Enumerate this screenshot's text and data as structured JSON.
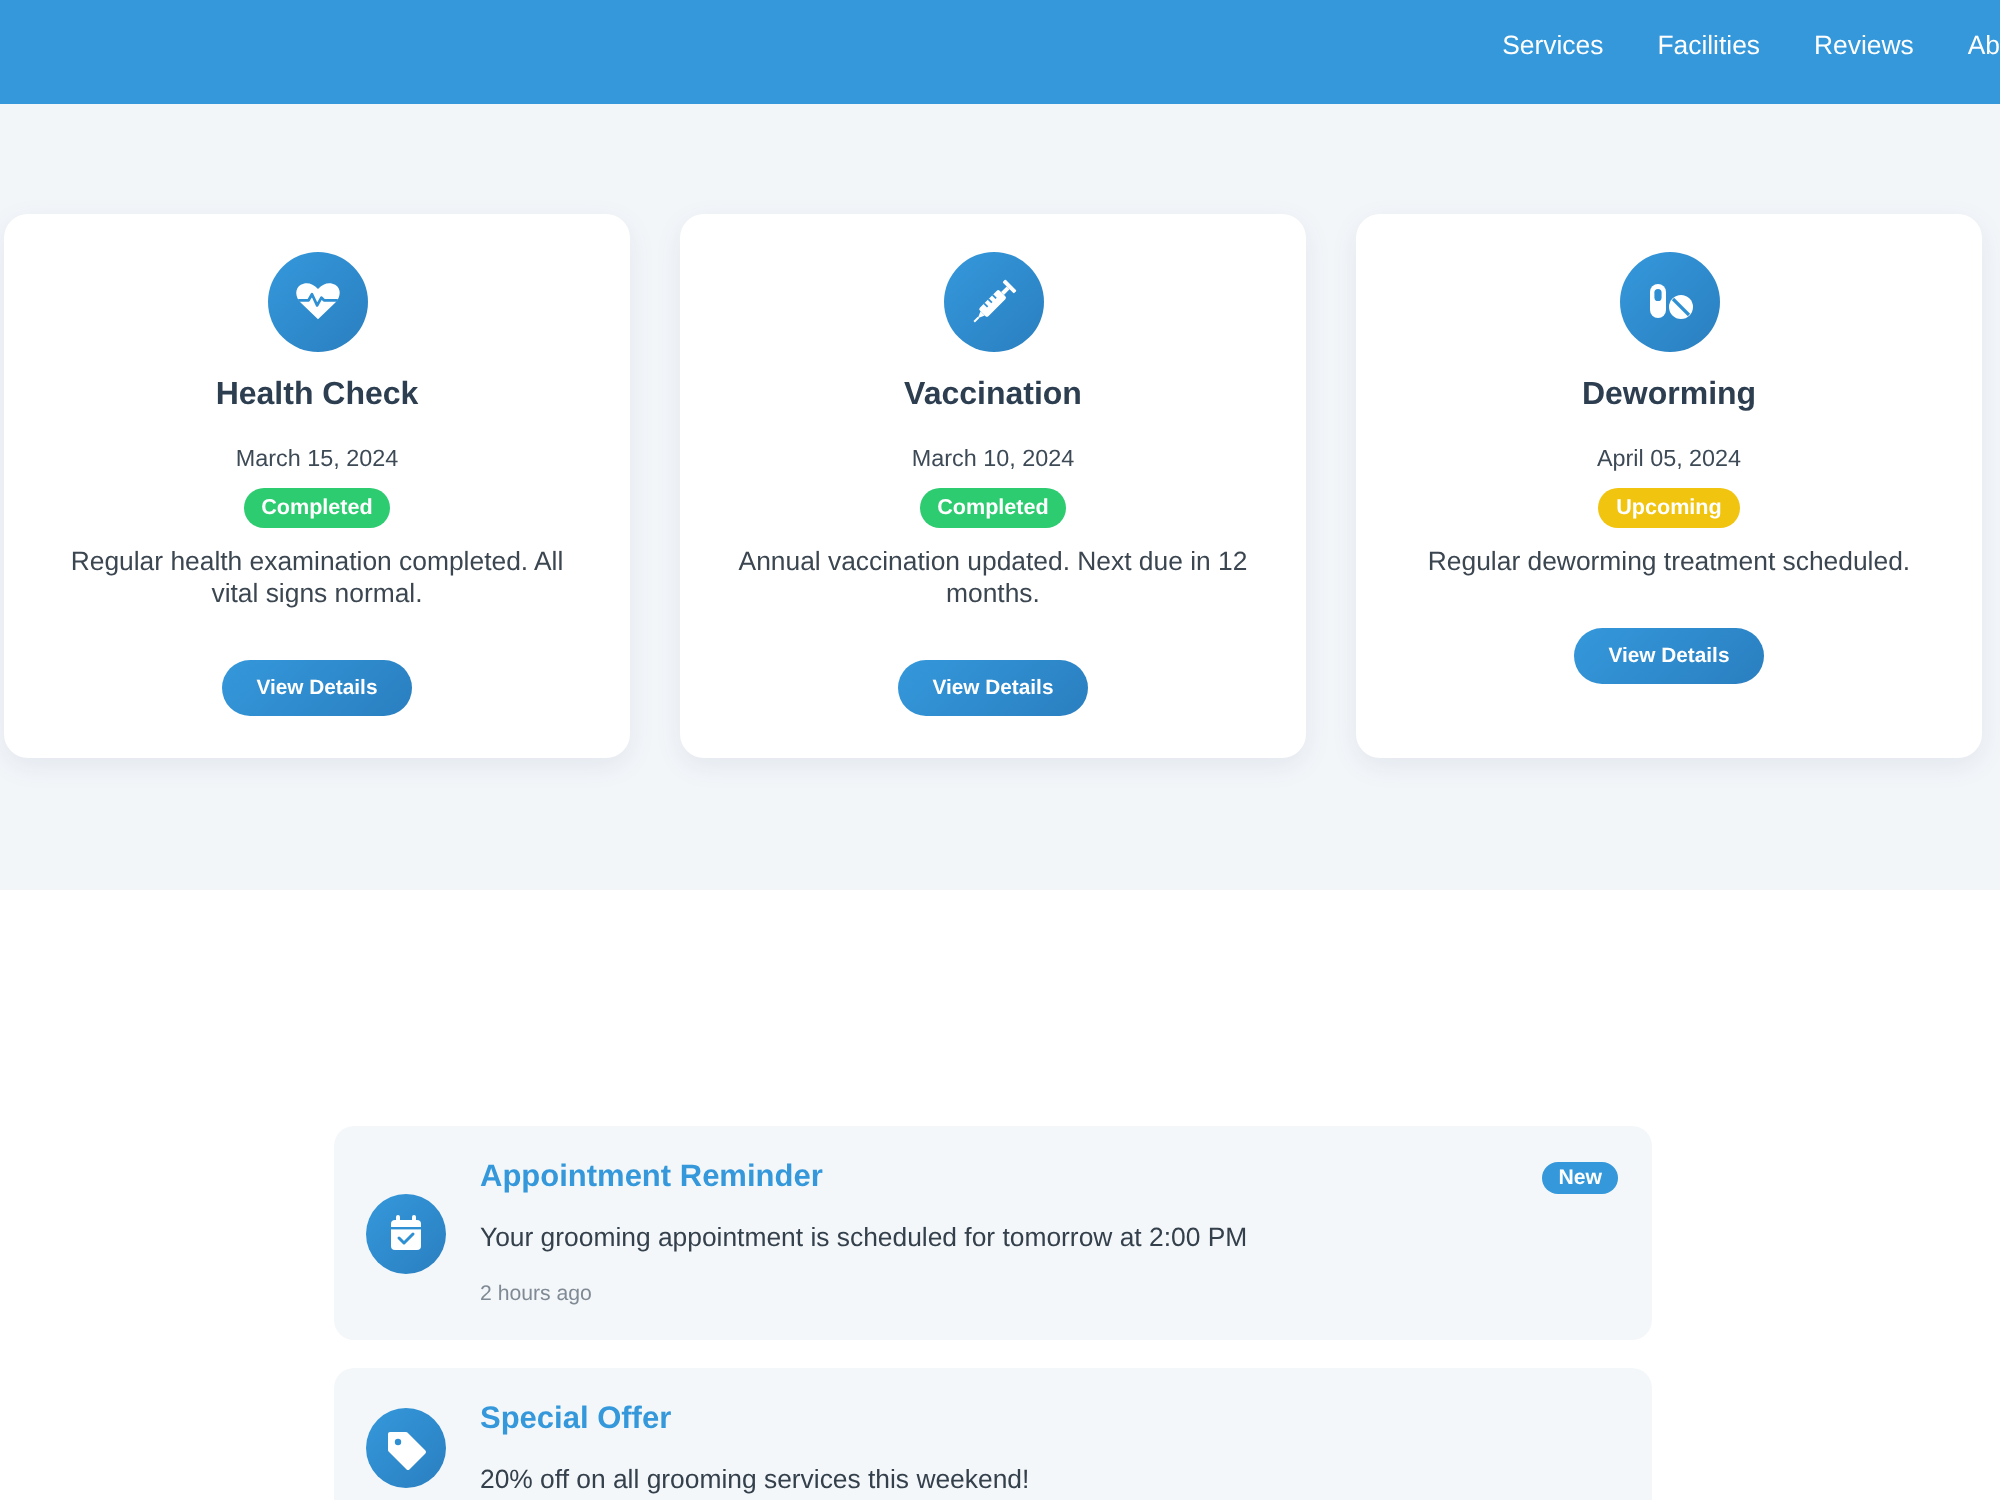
{
  "header": {
    "nav": [
      {
        "label": "Services"
      },
      {
        "label": "Facilities"
      },
      {
        "label": "Reviews"
      },
      {
        "label": "Ab"
      }
    ]
  },
  "services": [
    {
      "title": "Health Check",
      "date": "March 15, 2024",
      "status": {
        "label": "Completed",
        "color": "#2ecc71"
      },
      "text": "Regular health examination completed. All vital signs normal.",
      "button": "View Details"
    },
    {
      "title": "Vaccination",
      "date": "March 10, 2024",
      "status": {
        "label": "Completed",
        "color": "#2ecc71"
      },
      "text": "Annual vaccination updated. Next due in 12 months.",
      "button": "View Details"
    },
    {
      "title": "Deworming",
      "date": "April 05, 2024",
      "status": {
        "label": "Upcoming",
        "color": "#f1c40f"
      },
      "text": "Regular deworming treatment scheduled.",
      "button": "View Details"
    }
  ],
  "notifications": [
    {
      "title": "Appointment Reminder",
      "badge": "New",
      "text": "Your grooming appointment is scheduled for tomorrow at 2:00 PM",
      "time": "2 hours ago"
    },
    {
      "title": "Special Offer",
      "text": "20% off on all grooming services this weekend!"
    }
  ]
}
